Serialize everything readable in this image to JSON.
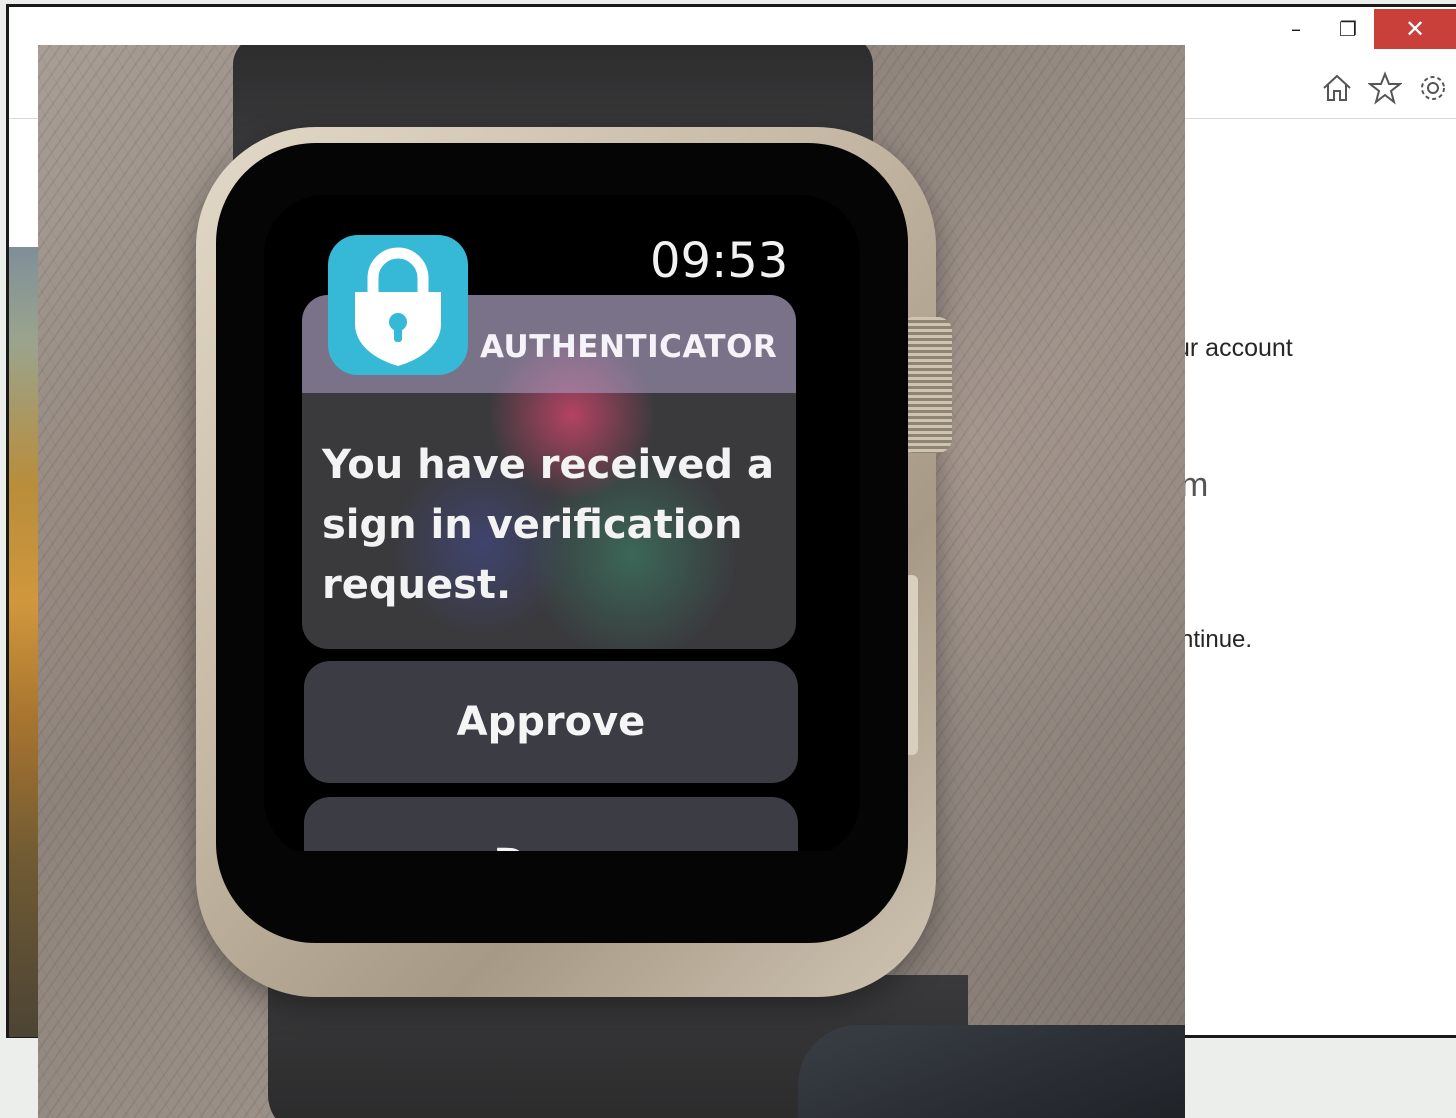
{
  "browser": {
    "caption": {
      "minimize": "–",
      "restore": "❐",
      "close": "✕"
    },
    "toolbar_icons": [
      "home-icon",
      "favorites-star-icon",
      "settings-gear-icon"
    ],
    "page_fragments": {
      "account": "ur account",
      "m": "m",
      "continue": "ntinue."
    }
  },
  "watch": {
    "app_icon": "authenticator-lock-icon",
    "time": "09:53",
    "notification": {
      "app_name": "AUTHENTICATOR",
      "body": "You have received a\nsign in verification\nrequest."
    },
    "approve_label": "Approve",
    "deny_label": "Deny"
  },
  "colors": {
    "close_button": "#c9403a",
    "app_icon": "#35b9d6",
    "watch_button": "#3b3c44"
  }
}
